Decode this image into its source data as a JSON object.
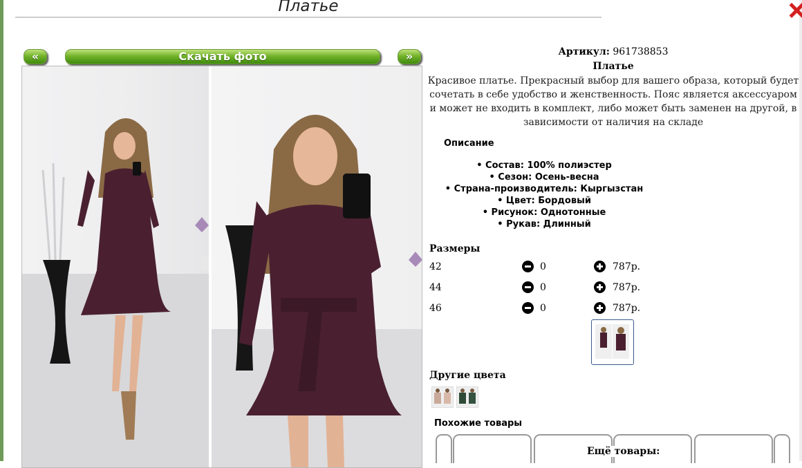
{
  "page": {
    "title": "Платье"
  },
  "gallery": {
    "prev_label": "«",
    "download_label": "Скачать фото",
    "next_label": "»"
  },
  "product": {
    "article_label": "Артикул:",
    "article_value": "961738853",
    "name": "Платье",
    "description": "Красивое платье. Прекрасный выбор для вашего образа, который будет сочетать в себе удобство и женственность. Пояс является аксессуаром и может не входить в комплект, либо может быть заменен на другой, в зависимости от наличия на складе",
    "description_heading": "Описание",
    "specs": [
      "Состав: 100% полиэстер",
      "Сезон: Осень-весна",
      "Страна-производитель: Кыргызстан",
      "Цвет: Бордовый",
      "Рисунок: Однотонные",
      "Рукав: Длинный"
    ]
  },
  "sizes": {
    "heading": "Размеры",
    "rows": [
      {
        "size": "42",
        "qty": "0",
        "price": "787р."
      },
      {
        "size": "44",
        "qty": "0",
        "price": "787р."
      },
      {
        "size": "46",
        "qty": "0",
        "price": "787р."
      }
    ]
  },
  "other_colors": {
    "heading": "Другие цвета"
  },
  "similar": {
    "heading": "Похожие товары",
    "more_label": "Ещё товары:"
  },
  "colors": {
    "accent_green": "#74b42c",
    "dress": "#4a2030",
    "close": "#d42020"
  }
}
